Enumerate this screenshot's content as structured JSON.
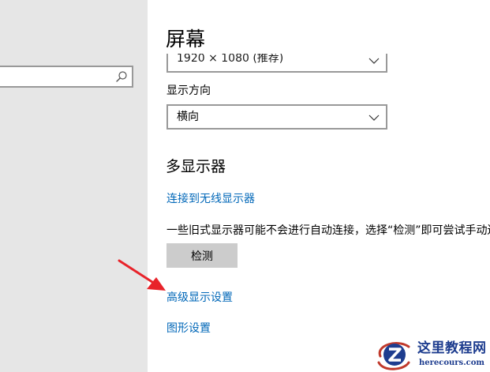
{
  "colors": {
    "left_pane_bg": "#e6e6e6",
    "link": "#0067b8",
    "button_bg": "#cccccc",
    "annotation_arrow": "#e8232a",
    "watermark_text": "#1e3d8f"
  },
  "sidebar": {
    "search": {
      "value": "",
      "icon": "search-icon"
    }
  },
  "main": {
    "title": "屏幕",
    "resolution": {
      "value": "1920 × 1080 (推荐)",
      "icon": "chevron-down-icon"
    },
    "orientation": {
      "label": "显示方向",
      "value": "横向",
      "icon": "chevron-down-icon"
    },
    "multi_display": {
      "title": "多显示器",
      "wireless_link": "连接到无线显示器",
      "description": "一些旧式显示器可能不会进行自动连接，选择“检测”即可尝试手动连",
      "detect_button": "检测"
    },
    "advanced_link": "高级显示设置",
    "graphics_link": "图形设置"
  },
  "annotation": {
    "icon": "red-arrow-icon"
  },
  "watermark": {
    "title": "这里教程网",
    "url": "herecours.com",
    "icon": "z-logo-icon"
  }
}
